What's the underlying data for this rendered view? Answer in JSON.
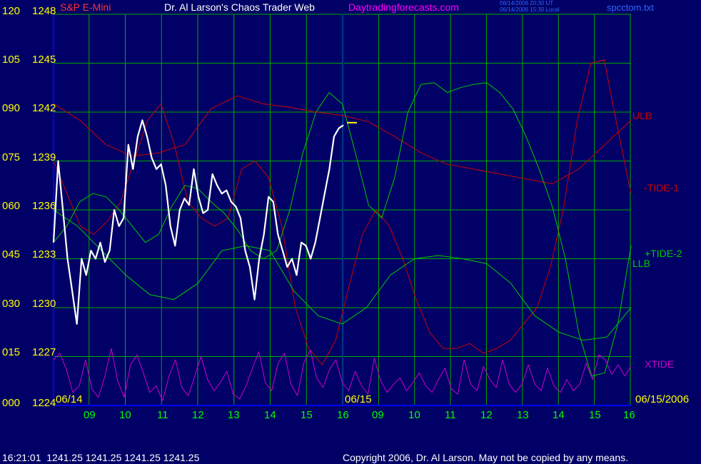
{
  "header": {
    "symbol": "S&P E-Mini",
    "title": "Dr. Al Larson's Chaos Trader Web",
    "site": "Daytradingforecasts.com",
    "time_ut": "06/14/2006 20:30 UT",
    "time_local": "06/14/2006 15:30 Local",
    "file": "spcctom.txt"
  },
  "footer": {
    "quote": "16:21:01  1241.25 1241.25 1241.25 1241.25",
    "copyright": "Copyright 2006, Dr. Al Larson. May not be copied by any means."
  },
  "colors": {
    "background": "#000066",
    "grid": "#00aa00",
    "axis_text": "#ffff00",
    "time_text": "#00ff00",
    "ulb_tide1": "#cc0000",
    "tide2_llb": "#00cc00",
    "xtide": "#cc00cc",
    "divider": "#0000ff",
    "price_bar": "#ffffff",
    "marker": "#ffff00",
    "title_text": "#ffffff",
    "site_text": "#ff00ff",
    "file_text": "#3366ff"
  },
  "chart_data": {
    "type": "line",
    "ylabels_left": [
      "000",
      "015",
      "030",
      "045",
      "060",
      "075",
      "090",
      "105",
      "120"
    ],
    "ylabels_price": [
      "1224",
      "1227",
      "1230",
      "1233",
      "1236",
      "1239",
      "1242",
      "1245",
      "1248"
    ],
    "ylim_price": [
      1224,
      1248
    ],
    "ylim_index": [
      0,
      120
    ],
    "x_hours": [
      "09",
      "10",
      "11",
      "12",
      "13",
      "14",
      "15",
      "16",
      "09",
      "10",
      "11",
      "12",
      "13",
      "14",
      "15",
      "16"
    ],
    "date_labels": [
      "06/14",
      "06/15",
      "06/15/2006"
    ],
    "series": [
      {
        "name": "ULB",
        "color": "#cc0000",
        "values": [
          1242.5,
          1241.5,
          1240,
          1239.3,
          1239.5,
          1240,
          1242.2,
          1243,
          1242.5,
          1242.3,
          1242,
          1241.8,
          1241.4,
          1240.5,
          1239.5,
          1238.8,
          1238.5,
          1238.2,
          1237.9,
          1237.6,
          1238.5,
          1240,
          1241.5
        ]
      },
      {
        "name": "-TIDE-1",
        "color": "#cc0000",
        "values": [
          1239,
          1237,
          1235,
          1234.5,
          1235.3,
          1236.5,
          1239,
          1241.5,
          1242.5,
          1240,
          1236.5,
          1235.5,
          1235,
          1235.5,
          1238.5,
          1239,
          1238,
          1235,
          1230,
          1227.5,
          1226.5,
          1228,
          1231.3,
          1234.5,
          1236,
          1235,
          1233,
          1230.5,
          1228.5,
          1227.5,
          1227.5,
          1227.8,
          1227.2,
          1227.5,
          1228,
          1229,
          1230,
          1232.5,
          1236.2,
          1241.5,
          1245,
          1245.2,
          1241,
          1237
        ]
      },
      {
        "name": "+TIDE-2",
        "color": "#00cc00",
        "values": [
          1234,
          1235,
          1236.5,
          1237,
          1236.8,
          1236,
          1235,
          1234,
          1234.5,
          1236.2,
          1237.5,
          1237.3,
          1236.5,
          1235.8,
          1234.8,
          1233.5,
          1233,
          1233.5,
          1236,
          1239.5,
          1242,
          1243.2,
          1242.5,
          1239.5,
          1236.3,
          1235.5,
          1238,
          1242,
          1243.7,
          1243.8,
          1243.2,
          1243.5,
          1243.7,
          1243.8,
          1243.2,
          1242.2,
          1240.5,
          1238.5,
          1236.2,
          1233,
          1228.5,
          1225.8,
          1226,
          1229,
          1233.8
        ]
      },
      {
        "name": "LLB",
        "color": "#00cc00",
        "values": [
          1236,
          1235,
          1233.5,
          1232,
          1230.8,
          1230.5,
          1231.5,
          1233.5,
          1233.8,
          1233.5,
          1231,
          1229.5,
          1229,
          1230,
          1232,
          1233,
          1233.2,
          1233,
          1232.7,
          1231.5,
          1229.5,
          1228.5,
          1228,
          1228.2,
          1230
        ]
      },
      {
        "name": "XTIDE",
        "color": "#cc00cc",
        "values": [
          1226.8,
          1227.2,
          1226.2,
          1224.8,
          1225.2,
          1226.8,
          1225,
          1224.5,
          1225.8,
          1227.5,
          1225.5,
          1224.5,
          1226.5,
          1227.1,
          1226,
          1224.8,
          1225.2,
          1224.3,
          1225.8,
          1226.8,
          1225.1,
          1224.6,
          1225.8,
          1227,
          1225.6,
          1224.9,
          1225.4,
          1226.1,
          1224.7,
          1224.4,
          1225.2,
          1226.3,
          1227.3,
          1225.4,
          1224.9,
          1226.6,
          1227.2,
          1225.3,
          1224.6,
          1226.6,
          1227.4,
          1225.7,
          1225.1,
          1226.2,
          1226.8,
          1225.4,
          1224.9,
          1226.1,
          1225.2,
          1224.7,
          1226.9,
          1225.5,
          1224.8,
          1225.3,
          1225.7,
          1224.9,
          1225.4,
          1226,
          1225.2,
          1224.8,
          1225.6,
          1226.3,
          1225,
          1224.7,
          1226.8,
          1225.3,
          1224.9,
          1226.4,
          1225.6,
          1225.1,
          1226.8,
          1225.3,
          1224.8,
          1225.3,
          1226.5,
          1225.3,
          1224.9,
          1226.3,
          1225.2,
          1224.8,
          1225.6,
          1224.9,
          1225.3,
          1226.6,
          1225.6,
          1227.1,
          1226.8,
          1225.9,
          1226.5,
          1225.8,
          1226.4
        ]
      },
      {
        "name": "Price",
        "color": "#ffffff",
        "values": [
          1234,
          1239,
          1236,
          1233,
          1231,
          1229,
          1233,
          1232,
          1233.5,
          1233,
          1234,
          1232.8,
          1233.5,
          1236,
          1235,
          1235.5,
          1240,
          1238.5,
          1240.5,
          1241.5,
          1240.5,
          1239.2,
          1238.5,
          1238.8,
          1237.5,
          1235,
          1233.8,
          1236,
          1236.7,
          1236.3,
          1238.5,
          1236.8,
          1235.8,
          1236,
          1238.2,
          1237.5,
          1237,
          1237.2,
          1236.5,
          1236.2,
          1235.5,
          1233.5,
          1232.5,
          1230.5,
          1233,
          1234.5,
          1236.8,
          1236.5,
          1234.5,
          1233.5,
          1232.5,
          1233,
          1232,
          1234,
          1233.8,
          1233,
          1234,
          1235.5,
          1237,
          1238.5,
          1240.5,
          1241,
          1241.2
        ]
      }
    ],
    "annotations": [
      "ULB",
      "-TIDE-1",
      "+TIDE-2",
      "LLB",
      "XTIDE"
    ]
  }
}
